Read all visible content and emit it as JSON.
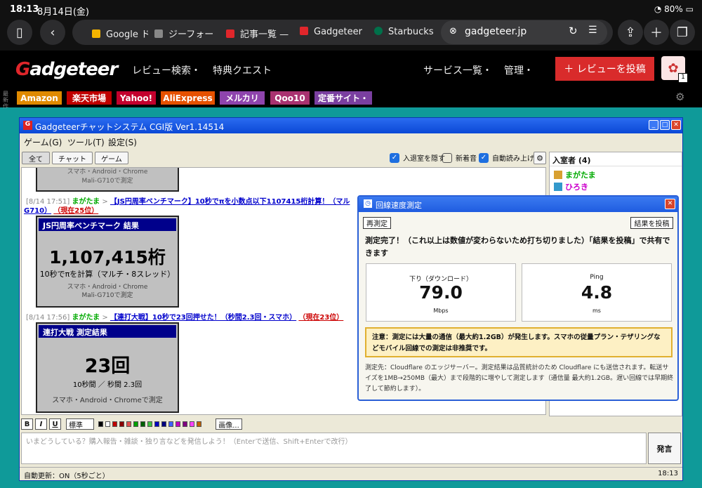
{
  "status": {
    "time": "18:13",
    "date": "8月14日(金)",
    "battery": "80%"
  },
  "browser": {
    "tabs": [
      "Google ド",
      "ジーフォー",
      "記事一覧 —",
      "Gadgeteer",
      "Starbucks"
    ],
    "address": "gadgeteer.jp"
  },
  "site": {
    "logo_first": "G",
    "logo_rest": "adgeteer",
    "nav": [
      "レビュー検索・",
      "特典クエスト"
    ],
    "nav_right": [
      "サービス一覧・",
      "管理・"
    ],
    "post_button": "＋ レビューを投稿",
    "notif_count": "1",
    "links": [
      {
        "label": "Amazon",
        "color": "#e08a00"
      },
      {
        "label": "楽天市場",
        "color": "#bf0000"
      },
      {
        "label": "Yahoo!",
        "color": "#c3002d"
      },
      {
        "label": "AliExpress",
        "color": "#e65100"
      },
      {
        "label": "メルカリ",
        "color": "#8e44ad"
      },
      {
        "label": "Qoo10",
        "color": "#a93270"
      },
      {
        "label": "定番サイト・",
        "color": "#7a3fa0"
      }
    ],
    "side_label": "最新作"
  },
  "chat": {
    "title": "Gadgeteerチャットシステム CGI版 Ver1.14514",
    "menu": [
      "ゲーム(G)",
      "ツール(T)",
      "設定(S)"
    ],
    "filters": [
      "全て",
      "チャット",
      "ゲーム"
    ],
    "options": [
      "入退室を隠す",
      "新着音",
      "自動読み上げ"
    ],
    "users_header": "入室者 (4)",
    "users": [
      "まがたま",
      "ひろき"
    ],
    "card0": {
      "line1": "スマホ・Android・Chrome",
      "line2": "Mali-G710で測定"
    },
    "msg1": {
      "time": "[8/14 17:51]",
      "user": "まがたま",
      "arrow": ">",
      "link": "【JS円周率ベンチマーク】10秒でπを小数点以下1107415桁計算！（マル",
      "link2": "G710）",
      "rank": "（現在25位）"
    },
    "card1": {
      "head": "JS円周率ベンチマーク 結果",
      "big": "1,107,415桁",
      "mid": "10秒でπを計算（マルチ・8スレッド）",
      "line1": "スマホ・Android・Chrome",
      "line2": "Mali-G710で測定"
    },
    "msg2": {
      "time": "[8/14 17:56]",
      "user": "まがたま",
      "arrow": ">",
      "link": "【連打大戦】10秒で23回押せた！（秒間2.3回・スマホ）",
      "rank": "（現在23位）"
    },
    "card2": {
      "head": "連打大戦 測定結果",
      "big": "23回",
      "mid": "10秒間 ／ 秒間 2.3回",
      "line1": "スマホ・Android・Chromeで測定"
    },
    "format": {
      "bold": "B",
      "italic": "I",
      "underline": "U",
      "size": "標準",
      "image": "画像..."
    },
    "swatches": [
      "#000000",
      "#ffffff",
      "#c00000",
      "#8b0000",
      "#e05050",
      "#00a000",
      "#006000",
      "#40c040",
      "#0000c0",
      "#000080",
      "#4060ff",
      "#c000c0",
      "#800080",
      "#ff40ff",
      "#c06000"
    ],
    "input_placeholder": "いまどうしている？購入報告・雑談・独り言などを発信しよう！（Enterで送信、Shift+Enterで改行）",
    "send": "発言",
    "footer_status": "自動更新：ON（5秒ごと）",
    "footer_time": "18:13"
  },
  "speedtest": {
    "title": "回線速度測定",
    "retest": "再測定",
    "post": "結果を投稿",
    "message": "測定完了！（これ以上は数値が変わらないため打ち切りました）「結果を投稿」で共有できます",
    "download_label": "下り（ダウンロード）",
    "download_value": "79.0",
    "download_unit": "Mbps",
    "ping_label": "Ping",
    "ping_value": "4.8",
    "ping_unit": "ms",
    "warning": "注意：測定には大量の通信（最大約1.2GB）が発生します。スマホの従量プラン・テザリングなどモバイル回線での測定は非推奨です。",
    "note": "測定先：Cloudflare のエッジサーバー。測定結果は品質統計のため Cloudflare にも送信されます。転送サイズを1MB→250MB（最大）まで段階的に増やして測定します（通信量 最大約1.2GB。遅い回線では早期終了して節約します）。"
  }
}
